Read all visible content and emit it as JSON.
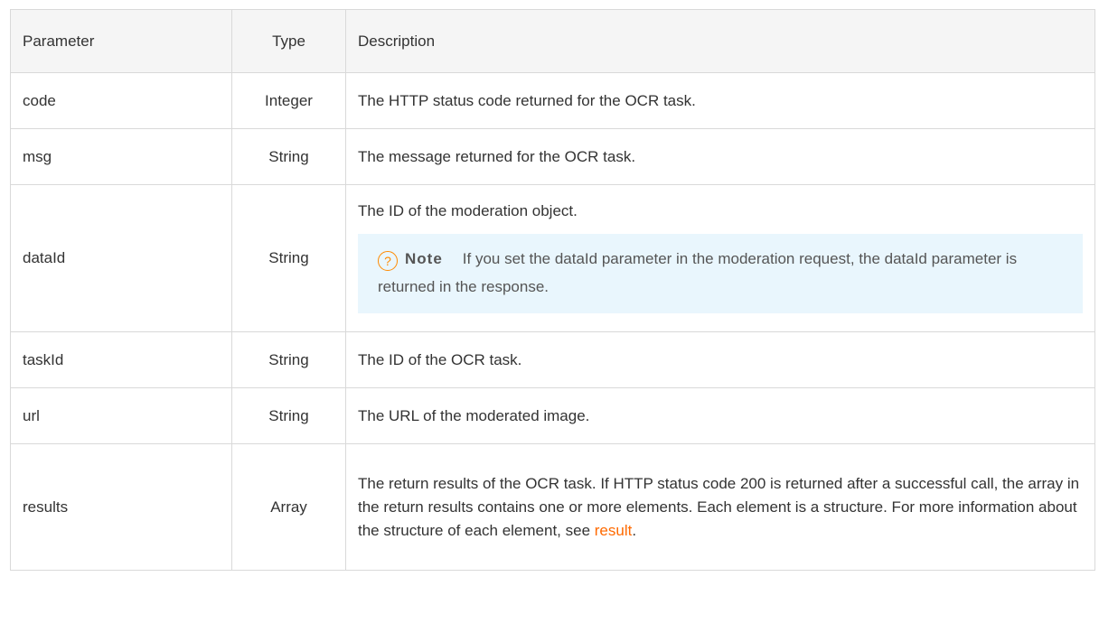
{
  "table": {
    "headers": {
      "parameter": "Parameter",
      "type": "Type",
      "description": "Description"
    },
    "rows": {
      "code": {
        "parameter": "code",
        "type": "Integer",
        "description": "The HTTP status code returned for the OCR task."
      },
      "msg": {
        "parameter": "msg",
        "type": "String",
        "description": "The message returned for the OCR task."
      },
      "dataId": {
        "parameter": "dataId",
        "type": "String",
        "description": "The ID of the moderation object.",
        "note_label": "Note",
        "note_text": "If you set the dataId parameter in the moderation request, the dataId parameter is returned in the response."
      },
      "taskId": {
        "parameter": "taskId",
        "type": "String",
        "description": "The ID of the OCR task."
      },
      "url": {
        "parameter": "url",
        "type": "String",
        "description": "The URL of the moderated image."
      },
      "results": {
        "parameter": "results",
        "type": "Array",
        "description": "The return results of the OCR task. If HTTP status code 200 is returned after a successful call, the array in the return results contains one or more elements. Each element is a structure. For more information about the structure of each element, see ",
        "link_text": "result",
        "trailing": "."
      }
    }
  },
  "icons": {
    "note": "question-circle-icon"
  },
  "colors": {
    "link": "#ff6a00",
    "note_background": "#e9f6fd",
    "note_icon": "#ff8a00",
    "header_background": "#f5f5f5",
    "border": "#d9d9d9"
  }
}
